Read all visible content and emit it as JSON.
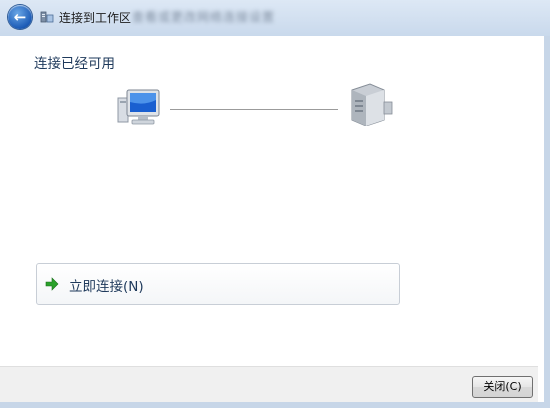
{
  "window": {
    "title": "连接到工作区",
    "blurred_title": "查看或更改网络连接设置"
  },
  "main": {
    "heading": "连接已经可用",
    "connect_now_label": "立即连接(N)"
  },
  "footer": {
    "close_label": "关闭(C)"
  },
  "icons": {
    "back": "back-arrow-icon",
    "title": "network-workplace-icon",
    "computer": "computer-icon",
    "server": "server-icon",
    "connect": "green-arrow-icon"
  },
  "colors": {
    "text_blue": "#1e395b",
    "arrow_green": "#2aa12a",
    "titlebar": "#c9d9ec"
  }
}
